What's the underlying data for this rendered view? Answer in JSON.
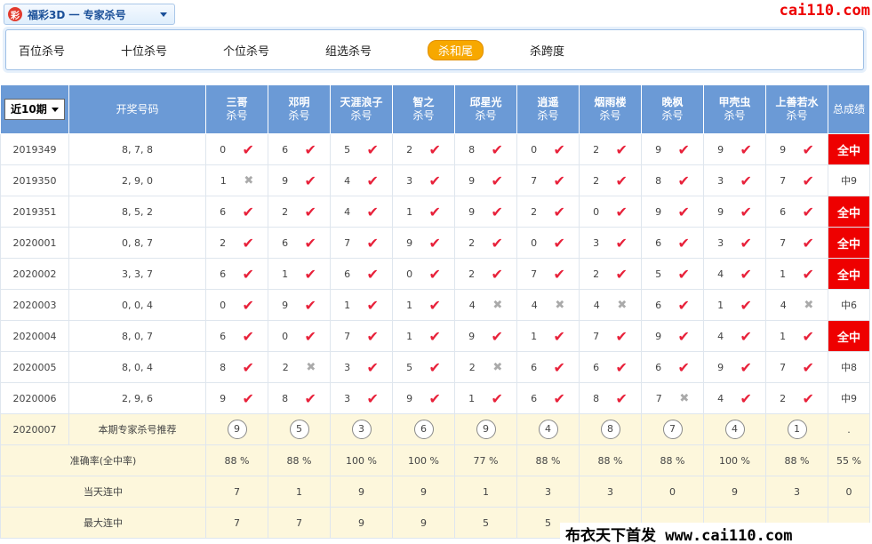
{
  "header": {
    "selector_icon": "彩",
    "selector_label": "福彩3D 一 专家杀号",
    "brand": "cai110.com"
  },
  "tabs": [
    {
      "label": "百位杀号",
      "active": false
    },
    {
      "label": "十位杀号",
      "active": false
    },
    {
      "label": "个位杀号",
      "active": false
    },
    {
      "label": "组选杀号",
      "active": false
    },
    {
      "label": "杀和尾",
      "active": true
    },
    {
      "label": "杀跨度",
      "active": false
    }
  ],
  "table": {
    "period_select": "近10期",
    "col_draw": "开奖号码",
    "expert_sub": "杀号",
    "col_total": "总成绩",
    "experts": [
      "三哥",
      "邓明",
      "天涯浪子",
      "智之",
      "邱星光",
      "逍遥",
      "烟雨楼",
      "晚枫",
      "甲壳虫",
      "上善若水"
    ],
    "rows": [
      {
        "period": "2019349",
        "draw": "8, 7, 8",
        "vals": [
          "0",
          "6",
          "5",
          "2",
          "8",
          "0",
          "2",
          "9",
          "9",
          "9"
        ],
        "hits": [
          1,
          1,
          1,
          1,
          1,
          1,
          1,
          1,
          1,
          1
        ],
        "total": "全中",
        "win": true
      },
      {
        "period": "2019350",
        "draw": "2, 9, 0",
        "vals": [
          "1",
          "9",
          "4",
          "3",
          "9",
          "7",
          "2",
          "8",
          "3",
          "7"
        ],
        "hits": [
          0,
          1,
          1,
          1,
          1,
          1,
          1,
          1,
          1,
          1
        ],
        "total": "中9",
        "win": false
      },
      {
        "period": "2019351",
        "draw": "8, 5, 2",
        "vals": [
          "6",
          "2",
          "4",
          "1",
          "9",
          "2",
          "0",
          "9",
          "9",
          "6"
        ],
        "hits": [
          1,
          1,
          1,
          1,
          1,
          1,
          1,
          1,
          1,
          1
        ],
        "total": "全中",
        "win": true
      },
      {
        "period": "2020001",
        "draw": "0, 8, 7",
        "vals": [
          "2",
          "6",
          "7",
          "9",
          "2",
          "0",
          "3",
          "6",
          "3",
          "7"
        ],
        "hits": [
          1,
          1,
          1,
          1,
          1,
          1,
          1,
          1,
          1,
          1
        ],
        "total": "全中",
        "win": true
      },
      {
        "period": "2020002",
        "draw": "3, 3, 7",
        "vals": [
          "6",
          "1",
          "6",
          "0",
          "2",
          "7",
          "2",
          "5",
          "4",
          "1"
        ],
        "hits": [
          1,
          1,
          1,
          1,
          1,
          1,
          1,
          1,
          1,
          1
        ],
        "total": "全中",
        "win": true
      },
      {
        "period": "2020003",
        "draw": "0, 0, 4",
        "vals": [
          "0",
          "9",
          "1",
          "1",
          "4",
          "4",
          "4",
          "6",
          "1",
          "4"
        ],
        "hits": [
          1,
          1,
          1,
          1,
          0,
          0,
          0,
          1,
          1,
          0
        ],
        "total": "中6",
        "win": false
      },
      {
        "period": "2020004",
        "draw": "8, 0, 7",
        "vals": [
          "6",
          "0",
          "7",
          "1",
          "9",
          "1",
          "7",
          "9",
          "4",
          "1"
        ],
        "hits": [
          1,
          1,
          1,
          1,
          1,
          1,
          1,
          1,
          1,
          1
        ],
        "total": "全中",
        "win": true
      },
      {
        "period": "2020005",
        "draw": "8, 0, 4",
        "vals": [
          "8",
          "2",
          "3",
          "5",
          "2",
          "6",
          "6",
          "6",
          "9",
          "7"
        ],
        "hits": [
          1,
          0,
          1,
          1,
          0,
          1,
          1,
          1,
          1,
          1
        ],
        "total": "中8",
        "win": false
      },
      {
        "period": "2020006",
        "draw": "2, 9, 6",
        "vals": [
          "9",
          "8",
          "3",
          "9",
          "1",
          "6",
          "8",
          "7",
          "4",
          "2"
        ],
        "hits": [
          1,
          1,
          1,
          1,
          1,
          1,
          1,
          0,
          1,
          1
        ],
        "total": "中9",
        "win": false
      }
    ],
    "recommend": {
      "period": "2020007",
      "label": "本期专家杀号推荐",
      "vals": [
        "9",
        "5",
        "3",
        "6",
        "9",
        "4",
        "8",
        "7",
        "4",
        "1"
      ],
      "total": "."
    },
    "accuracy": {
      "label": "准确率(全中率)",
      "vals": [
        "88 %",
        "88 %",
        "100 %",
        "100 %",
        "77 %",
        "88 %",
        "88 %",
        "88 %",
        "100 %",
        "88 %"
      ],
      "total": "55 %"
    },
    "today_streak": {
      "label": "当天连中",
      "vals": [
        "7",
        "1",
        "9",
        "9",
        "1",
        "3",
        "3",
        "0",
        "9",
        "3"
      ],
      "total": "0"
    },
    "max_streak": {
      "label": "最大连中",
      "vals": [
        "7",
        "7",
        "9",
        "9",
        "5",
        "5",
        "",
        "",
        "",
        ""
      ],
      "total": ""
    }
  },
  "footer": "布衣天下首发 www.cai110.com",
  "colors": {
    "header_bg": "#6b9ad6",
    "hit": "#e8213a",
    "miss": "#aaaaaa",
    "win_bg": "#ee0000",
    "tab_active": "#f7a800",
    "brand": "#ee0000"
  },
  "icons": {
    "hit": "check-mark",
    "miss": "cross-mark"
  }
}
